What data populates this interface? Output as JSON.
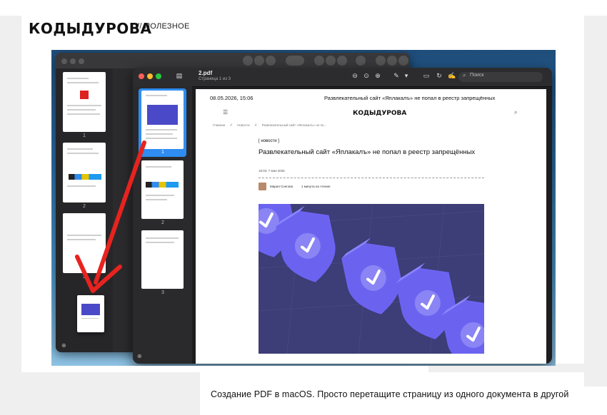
{
  "header": {
    "logo": "КОДЫДУРОВА",
    "section": "// ПОЛЕЗНОЕ"
  },
  "caption": "Создание PDF в macOS. Просто перетащите страницу из одного документа в другой",
  "back_window": {
    "thumbnails": [
      {
        "number": "1"
      },
      {
        "number": "2"
      },
      {
        "number": "3"
      }
    ]
  },
  "front_window": {
    "doc_name": "2.pdf",
    "page_info": "Страница 1 из 3",
    "search_placeholder": "Поиск",
    "thumbnails": [
      {
        "number": "1",
        "selected": true
      },
      {
        "number": "2",
        "selected": false
      },
      {
        "number": "3",
        "selected": false
      }
    ],
    "icons": [
      "zoom-out-icon",
      "zoom-fit-icon",
      "zoom-in-icon",
      "markup-icon",
      "chevron-down-icon",
      "display-icon",
      "rotate-icon",
      "sign-icon",
      "annotate-icon",
      "info-icon",
      "share-icon",
      "search-icon"
    ]
  },
  "pdf_page": {
    "date": "08.05.2026, 15:06",
    "header_title": "Развлекательный сайт «Яплакалъ» не попал в реестр запрещённых",
    "logo": "КОДЫДУРОВА",
    "breadcrumbs": [
      "Главная",
      "//",
      "Новости",
      "//",
      "Развлекательный сайт «Яплакалъ» не по..."
    ],
    "tag": "[ новости ]",
    "article_title": "Развлекательный сайт «Яплакалъ» не попал в реестр запрещённых",
    "article_date": "18:03, 7 мая 2026",
    "author": "Мария Снегова",
    "read_time": "1 минута на чтение"
  },
  "colors": {
    "accent_blue": "#2f8cf0",
    "hero_bg": "#3d3d77",
    "shield_purple": "#6b63f0",
    "arrow_red": "#e8231f"
  }
}
